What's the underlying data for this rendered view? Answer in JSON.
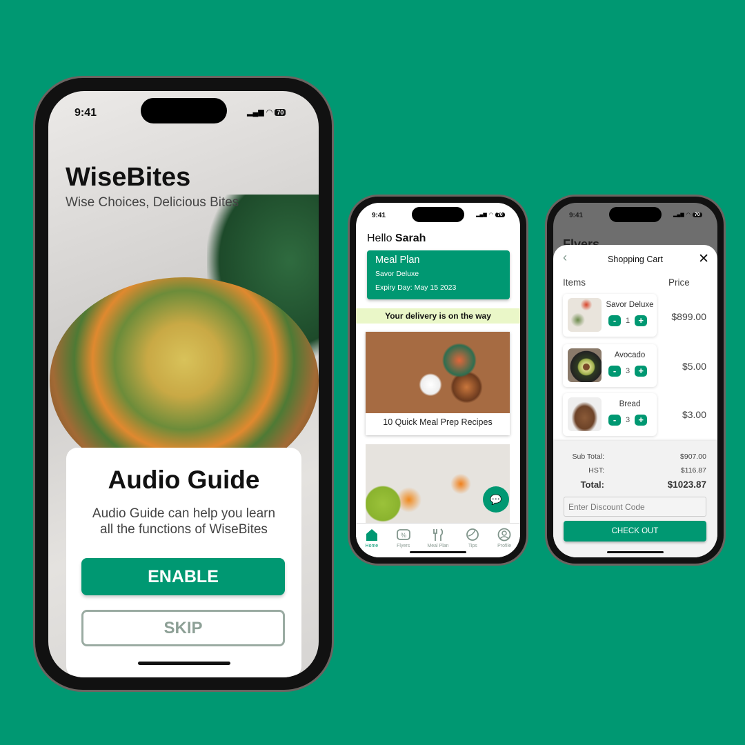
{
  "status": {
    "time": "9:41",
    "battery": "70"
  },
  "onboarding": {
    "app_name": "WiseBites",
    "tagline": "Wise Choices, Delicious Bites",
    "dialog": {
      "title": "Audio Guide",
      "body": "Audio Guide can help you learn all the functions of WiseBites",
      "enable": "ENABLE",
      "skip": "SKIP"
    }
  },
  "home": {
    "greeting": "Hello",
    "user": "Sarah",
    "meal_plan": {
      "title": "Meal Plan",
      "plan": "Savor Deluxe",
      "expiry": "Expiry Day: May 15 2023"
    },
    "banner": "Your delivery is on the way",
    "cards": [
      {
        "title": "10 Quick Meal Prep Recipes"
      }
    ],
    "nav": [
      {
        "label": "Home",
        "icon": "home-icon",
        "active": true
      },
      {
        "label": "Flyers",
        "icon": "coupon-icon"
      },
      {
        "label": "Meal Plan",
        "icon": "fork-knife-icon"
      },
      {
        "label": "Tips",
        "icon": "leaf-globe-icon"
      },
      {
        "label": "Profile",
        "icon": "profile-icon"
      }
    ]
  },
  "cart": {
    "bg_title": "Flyers",
    "title": "Shopping Cart",
    "col_items": "Items",
    "col_price": "Price",
    "items": [
      {
        "name": "Savor Deluxe",
        "qty": "1",
        "price": "$899.00"
      },
      {
        "name": "Avocado",
        "qty": "3",
        "price": "$5.00"
      },
      {
        "name": "Bread",
        "qty": "3",
        "price": "$3.00"
      }
    ],
    "minus": "-",
    "plus": "+",
    "subtotal_label": "Sub Total:",
    "subtotal": "$907.00",
    "hst_label": "HST:",
    "hst": "$116.87",
    "total_label": "Total:",
    "total": "$1023.87",
    "discount_placeholder": "Enter Discount Code",
    "checkout": "CHECK OUT"
  },
  "colors": {
    "brand": "#009872",
    "banner": "#eaf7c8"
  }
}
